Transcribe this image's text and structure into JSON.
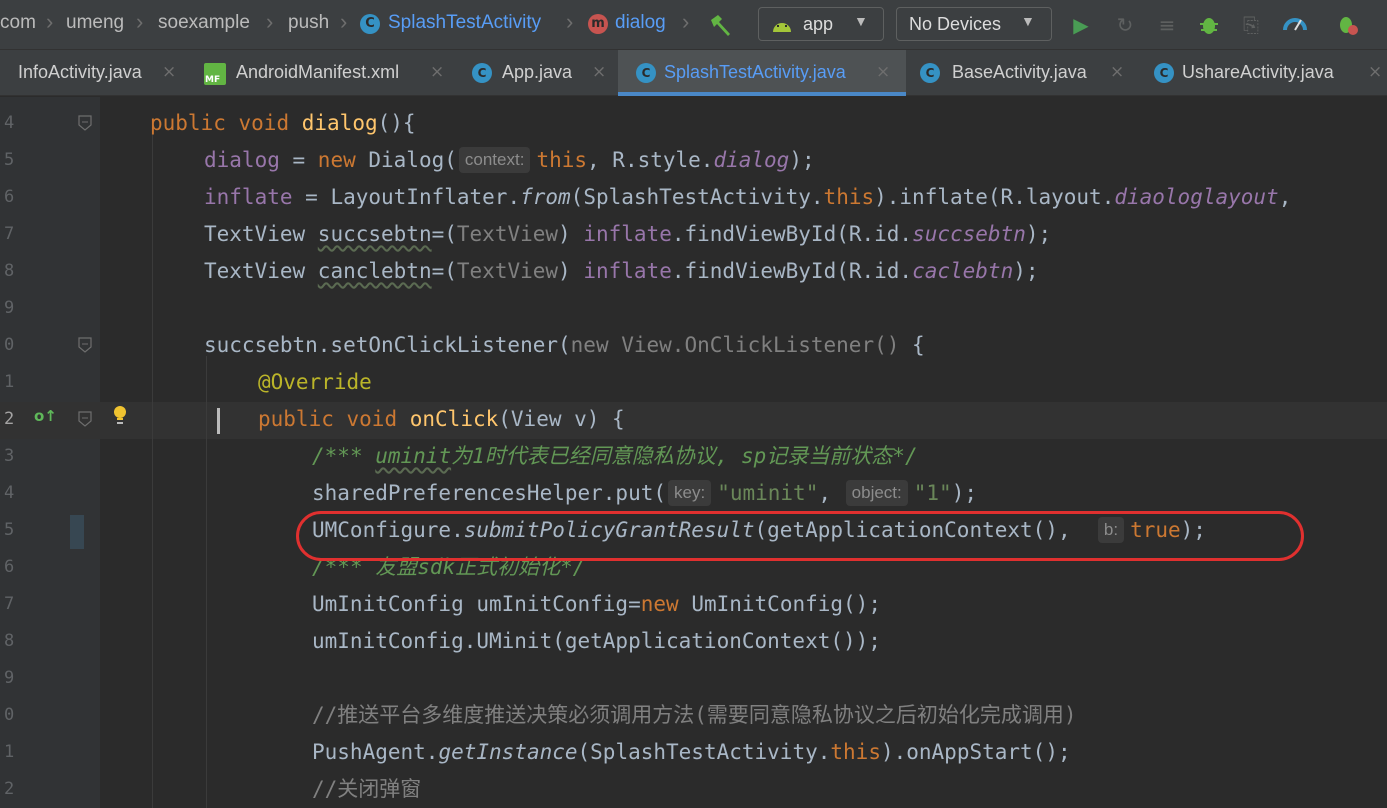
{
  "toolbar": {
    "breadcrumbs": [
      "com",
      "umeng",
      "soexample",
      "push",
      "SplashTestActivity",
      "dialog"
    ],
    "class_icon": "C",
    "method_icon": "m",
    "build_icon": "hammer-icon",
    "config_label": "app",
    "device_label": "No Devices",
    "icons": [
      "run-icon",
      "apply-changes-icon",
      "coverage-icon",
      "debug-icon",
      "attach-debugger-icon",
      "profiler-icon",
      "sync-icon"
    ],
    "colors": {
      "accent": "#589df6",
      "run": "#499c54",
      "debug": "#62b543"
    }
  },
  "tabs": [
    {
      "label": "InfoActivity.java"
    },
    {
      "label": "AndroidManifest.xml",
      "icon": "MF"
    },
    {
      "label": "App.java",
      "icon": "C"
    },
    {
      "label": "SplashTestActivity.java",
      "icon": "C",
      "active": true
    },
    {
      "label": "BaseActivity.java",
      "icon": "C"
    },
    {
      "label": "UshareActivity.java",
      "icon": "C"
    }
  ],
  "editor": {
    "line_numbers": [
      "4",
      "5",
      "6",
      "7",
      "8",
      "9",
      "0",
      "1",
      "2",
      "3",
      "4",
      "5",
      "6",
      "7",
      "8",
      "9",
      "0",
      "1",
      "2"
    ],
    "hints": {
      "context": "context:",
      "key": "key:",
      "object": "object:",
      "b": "b:"
    },
    "code": {
      "l1_public": "public",
      "l1_void": "void",
      "l1_name": "dialog",
      "l1_rest": "(){",
      "l2_var": "dialog",
      "l2_eq": " = ",
      "l2_new": "new",
      "l2_cls": " Dialog(",
      "l2_this": "this",
      "l2_mid": ", R.style.",
      "l2_field": "dialog",
      "l2_end": ");",
      "l3_var": "inflate",
      "l3_a": " = LayoutInflater.",
      "l3_from": "from",
      "l3_b": "(SplashTestActivity.",
      "l3_this": "this",
      "l3_c": ").inflate(R.layout.",
      "l3_field": "diaologlayout",
      "l3_d": ",",
      "l4_a": "TextView ",
      "l4_var": "succsebtn",
      "l4_b": "=(",
      "l4_cast": "TextView",
      "l4_c": ") ",
      "l4_inf": "inflate",
      "l4_d": ".findViewById(R.id.",
      "l4_field": "succsebtn",
      "l4_e": ");",
      "l5_a": "TextView ",
      "l5_var": "canclebtn",
      "l5_b": "=(",
      "l5_cast": "TextView",
      "l5_c": ") ",
      "l5_inf": "inflate",
      "l5_d": ".findViewById(R.id.",
      "l5_field": "caclebtn",
      "l5_e": ");",
      "l7_a": "succsebtn.setOnClickListener(",
      "l7_new": "new",
      "l7_b": " View.OnClickListener()",
      "l7_c": " {",
      "l8_ann": "@Override",
      "l9_public": "public",
      "l9_void": "void",
      "l9_name": "onClick",
      "l9_rest": "(View v) {",
      "l10_a": "/**",
      "l10_b": "* ",
      "l10_tag": "uminit",
      "l10_c": "为1时代表已经同意隐私协议, sp记录当前状态*/",
      "l11_a": "sharedPreferencesHelper.put(",
      "l11_s1": "\"uminit\"",
      "l11_b": ", ",
      "l11_s2": "\"1\"",
      "l11_c": ");",
      "l12_a": "UMConfigure.",
      "l12_m": "submitPolicyGrantResult",
      "l12_b": "(getApplicationContext(),",
      "l12_true": "true",
      "l12_c": ");",
      "l13_a": "/**",
      "l13_b": "* 友盟sdk正式初始化*/",
      "l14_a": "UmInitConfig umInitConfig=",
      "l14_new": "new",
      "l14_b": " UmInitConfig();",
      "l15_a": "umInitConfig.UMinit(getApplicationContext());",
      "l17_cmt": "//推送平台多维度推送决策必须调用方法(需要同意隐私协议之后初始化完成调用)",
      "l18_a": "PushAgent.",
      "l18_m": "getInstance",
      "l18_b": "(SplashTestActivity.",
      "l18_this": "this",
      "l18_c": ").onAppStart();",
      "l19_cmt": "//关闭弹窗"
    },
    "colors": {
      "keyword": "#cc7832",
      "function": "#ffc66d",
      "field": "#9876aa",
      "string": "#6a8759",
      "comment": "#808080",
      "annotation": "#bbb529",
      "highlight": "#e0302f"
    }
  }
}
